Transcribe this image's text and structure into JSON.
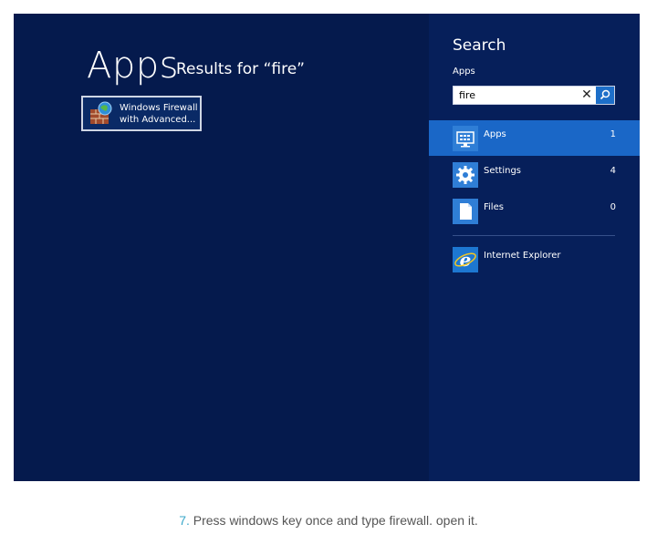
{
  "main": {
    "title": "Apps",
    "results_label": "Results for “fire”",
    "results": [
      {
        "line1": "Windows Firewall",
        "line2": "with Advanced..."
      }
    ]
  },
  "charm": {
    "title": "Search",
    "scope_label": "Apps",
    "query": "fire",
    "categories": [
      {
        "label": "Apps",
        "count": "1",
        "icon": "monitor-icon"
      },
      {
        "label": "Settings",
        "count": "4",
        "icon": "gear-icon"
      },
      {
        "label": "Files",
        "count": "0",
        "icon": "file-icon"
      }
    ],
    "apps": [
      {
        "label": "Internet Explorer",
        "icon": "internet-explorer-icon"
      }
    ]
  },
  "caption": {
    "number": "7.",
    "text": " Press windows key once and type firewall. open it."
  }
}
